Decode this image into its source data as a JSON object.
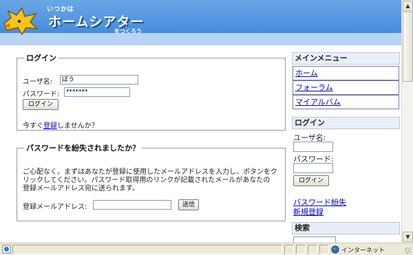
{
  "header": {
    "logo_small": "いつかは",
    "logo_main": "ホームシアター",
    "logo_sub": "をつくろう"
  },
  "login": {
    "legend": "ログイン",
    "username_label": "ユーザ名:",
    "username_value": "ぼう",
    "password_label": "パスワード:",
    "password_value": "*******",
    "login_button": "ログイン",
    "register_prefix": "今すぐ",
    "register_link": "登録",
    "register_suffix": "しませんか？"
  },
  "lost_password": {
    "legend": "パスワードを紛失されましたか？",
    "description_lines": [
      "ご心配なく。まずはあなたが登録に使用したメールアドレスを入力し、ボタンをク",
      "リックしてください。パスワード取得用のリンクが記載されたメールがあなたの",
      "登録メールアドレス宛に送られます。"
    ],
    "email_label": "登録メールアドレス:",
    "email_value": "",
    "send_button": "送信"
  },
  "sidebar": {
    "main_menu_title": "メインメニュー",
    "menu_items": [
      "ホーム",
      "フォーラム",
      "マイアルバム"
    ],
    "login_title": "ログイン",
    "username_label": "ユーザ名:",
    "password_label": "パスワード:",
    "login_button": "ログイン",
    "lost_password_link": "パスワード紛失",
    "register_link": "新規登録",
    "search_title": "検索"
  },
  "statusbar": {
    "zone": "インターネット"
  },
  "colors": {
    "header_blue": "#4f93df",
    "link": "#0000cc"
  }
}
